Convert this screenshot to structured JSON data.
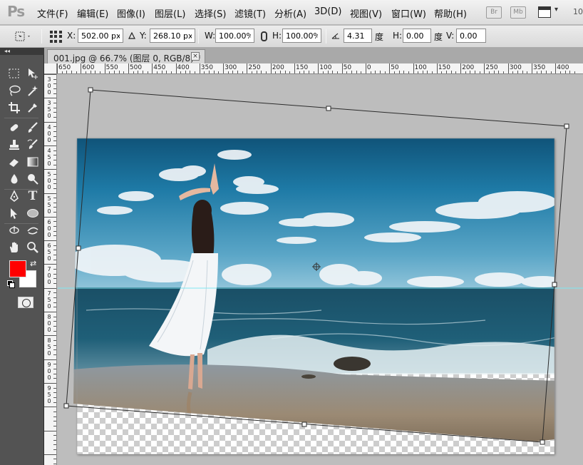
{
  "app": {
    "logo": "Ps",
    "menu": [
      "文件(F)",
      "编辑(E)",
      "图像(I)",
      "图层(L)",
      "选择(S)",
      "滤镜(T)",
      "分析(A)",
      "3D(D)",
      "视图(V)",
      "窗口(W)",
      "帮助(H)"
    ],
    "bridge_badge": "Br",
    "minibridge_badge": "Mb",
    "zoom_partial": "10"
  },
  "options": {
    "x_label": "X:",
    "x_value": "502.00 px",
    "y_label": "Y:",
    "y_value": "268.10 px",
    "w_label": "W:",
    "w_value": "100.00%",
    "h_label": "H:",
    "h_value": "100.00%",
    "angle_value": "4.31",
    "angle_unit": "度",
    "hskew_label": "H:",
    "hskew_value": "0.00",
    "hskew_unit": "度",
    "vskew_label": "V:",
    "vskew_value": "0.00"
  },
  "document": {
    "tab_label": "001.jpg @ 66.7% (图层 0, RGB/8) *",
    "close": "×"
  },
  "rulers": {
    "top": [
      "650",
      "600",
      "550",
      "500",
      "450",
      "400",
      "350",
      "300",
      "250",
      "200",
      "150",
      "100",
      "50",
      "0",
      "50",
      "100",
      "150",
      "200",
      "250",
      "300",
      "350",
      "400"
    ],
    "left_digits": [
      "3",
      "0",
      "0",
      "3",
      "5",
      "0",
      "4",
      "0",
      "0",
      "4",
      "5",
      "0",
      "5",
      "0",
      "0",
      "5",
      "5",
      "0",
      "6",
      "0",
      "0",
      "6",
      "5",
      "0",
      "7",
      "0",
      "0",
      "7",
      "5",
      "0",
      "8",
      "0",
      "0",
      "8",
      "5",
      "0",
      "9",
      "0",
      "0",
      "9",
      "5",
      "0"
    ]
  },
  "colors": {
    "foreground": "#ff0000",
    "background": "#ffffff",
    "guide": "#7fe7f2"
  },
  "tools": [
    "marquee-icon",
    "move-icon",
    "lasso-icon",
    "quick-select-icon",
    "crop-icon",
    "eyedropper-icon",
    "healing-icon",
    "brush-icon",
    "stamp-icon",
    "history-brush-icon",
    "eraser-icon",
    "gradient-icon",
    "blur-icon",
    "dodge-icon",
    "pen-icon",
    "type-icon",
    "path-select-icon",
    "ellipse-icon",
    "3d-rotate-icon",
    "3d-orbit-icon",
    "hand-icon",
    "zoom-icon"
  ]
}
